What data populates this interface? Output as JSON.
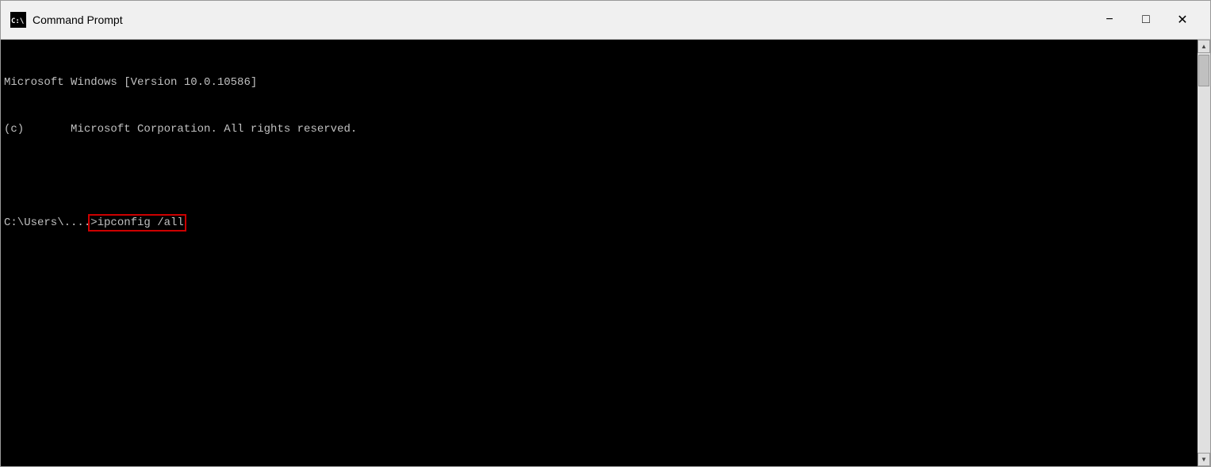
{
  "window": {
    "title": "Command Prompt",
    "icon": "cmd-icon"
  },
  "titlebar": {
    "minimize_label": "−",
    "maximize_label": "□",
    "close_label": "✕"
  },
  "terminal": {
    "line1": "Microsoft Windows [Version 10.0.10586]",
    "line2": "(c)       Microsoft Corporation. All rights reserved.",
    "line3": "",
    "prompt": "C:\\Users\\....",
    "command": ">ipconfig /all"
  }
}
